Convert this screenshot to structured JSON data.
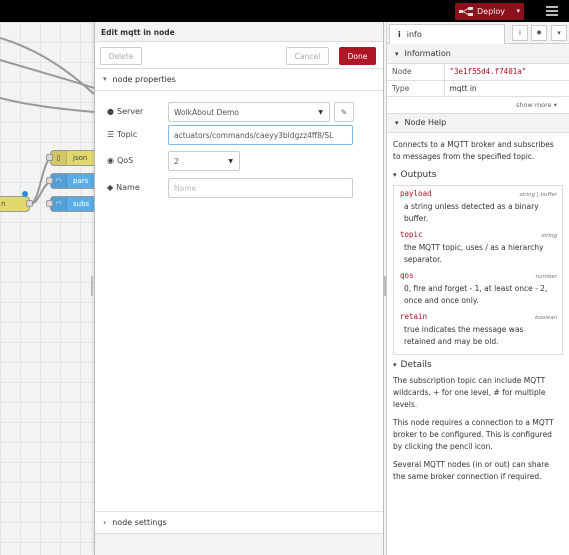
{
  "topbar": {
    "deploy_label": "Deploy"
  },
  "workspace": {
    "nodes": [
      {
        "label": "json"
      },
      {
        "label": "pars"
      },
      {
        "label": "subs"
      },
      {
        "label": "n"
      }
    ],
    "colors": {
      "function": "#e2d96e",
      "mqtt": "#5aaee8",
      "change": "#e2d96e"
    }
  },
  "tray": {
    "title": "Edit mqtt in node",
    "delete_label": "Delete",
    "cancel_label": "Cancel",
    "done_label": "Done",
    "properties_heading": "node properties",
    "settings_heading": "node settings",
    "server": {
      "label": "Server",
      "value": "WolkAbout Demo"
    },
    "topic": {
      "label": "Topic",
      "value": "actuators/commands/caeyy3bldgzz4ff8/SL"
    },
    "qos": {
      "label": "QoS",
      "value": "2"
    },
    "name": {
      "label": "Name",
      "placeholder": "Name"
    }
  },
  "sidebar": {
    "tab_label": "info",
    "information_heading": "Information",
    "props": [
      {
        "key": "Node",
        "value": "\"3e1f55d4.f7401a\""
      },
      {
        "key": "Type",
        "value": "mqtt in"
      }
    ],
    "show_more": "show more",
    "help_heading": "Node Help",
    "help_intro": "Connects to a MQTT broker and subscribes to messages from the specified topic.",
    "outputs_heading": "Outputs",
    "outputs": [
      {
        "name": "payload",
        "type": "string | buffer",
        "desc": "a string unless detected as a binary buffer."
      },
      {
        "name": "topic",
        "type": "string",
        "desc": "the MQTT topic, uses / as a hierarchy separator."
      },
      {
        "name": "qos",
        "type": "number",
        "desc": "0, fire and forget - 1, at least once - 2, once and once only."
      },
      {
        "name": "retain",
        "type": "boolean",
        "desc": "true indicates the message was retained and may be old."
      }
    ],
    "details_heading": "Details",
    "details": [
      "The subscription topic can include MQTT wildcards, + for one level, # for multiple levels.",
      "This node requires a connection to a MQTT broker to be configured. This is configured by clicking the pencil icon.",
      "Several MQTT nodes (in or out) can share the same broker connection if required."
    ]
  }
}
